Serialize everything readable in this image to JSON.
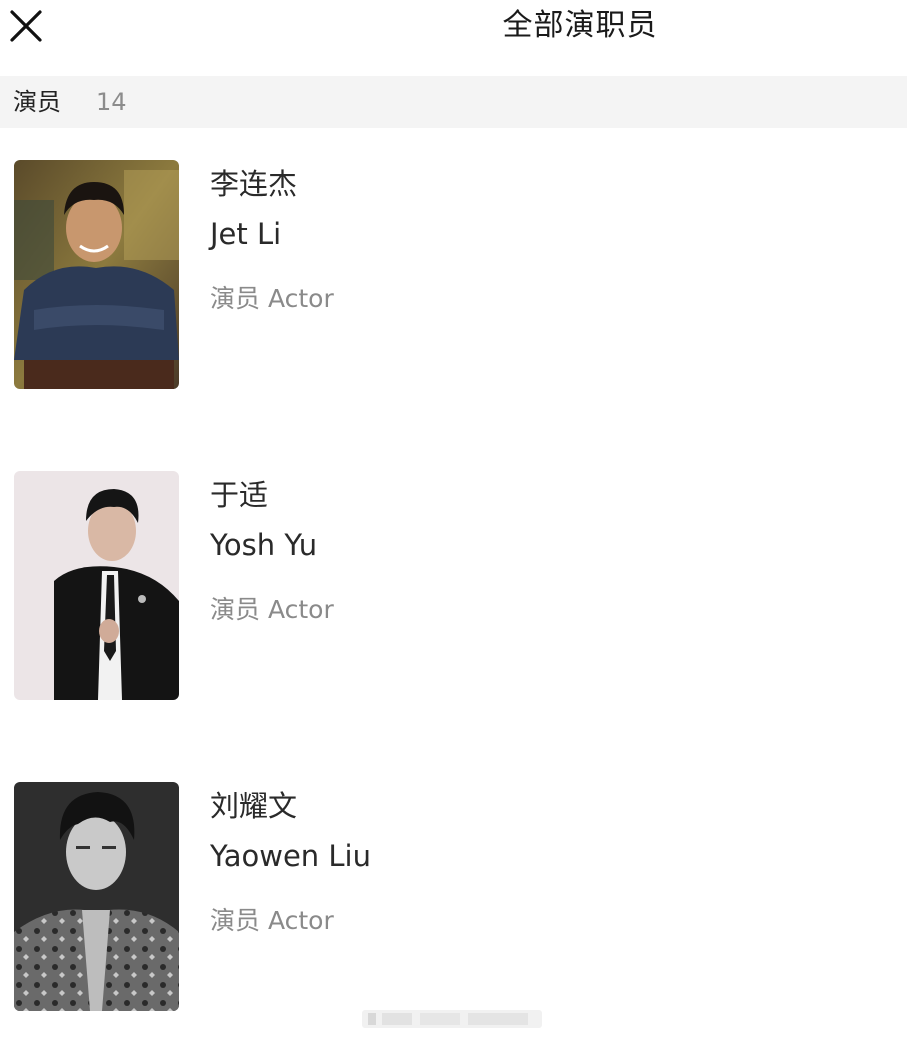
{
  "header": {
    "title": "全部演职员"
  },
  "section": {
    "label": "演员",
    "count": "14"
  },
  "cast": [
    {
      "name_cn": "李连杰",
      "name_en": "Jet Li",
      "role": "演员 Actor"
    },
    {
      "name_cn": "于适",
      "name_en": "Yosh Yu",
      "role": "演员 Actor"
    },
    {
      "name_cn": "刘耀文",
      "name_en": "Yaowen Liu",
      "role": "演员 Actor"
    }
  ],
  "colors": {
    "section_bg": "#f4f4f4",
    "secondary_text": "#8a8a8a",
    "primary_text": "#222222"
  },
  "icons": {
    "close": "close-icon"
  }
}
